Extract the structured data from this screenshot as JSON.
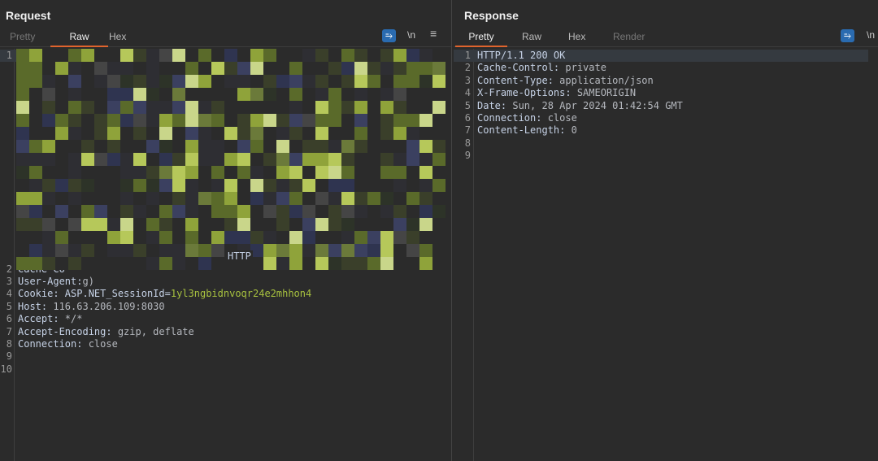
{
  "request": {
    "title": "Request",
    "tabs": [
      {
        "label": "Pretty"
      },
      {
        "label": "Raw",
        "active": true
      },
      {
        "label": "Hex"
      }
    ],
    "tools": {
      "wrap_icon": "wrap-lines-icon",
      "newline_label": "\\n",
      "menu_icon": "hamburger-menu-icon"
    },
    "redacted_line_1_tail": "HTTP",
    "lines": [
      {
        "n": "2",
        "key": "Cache-Co",
        "val": ""
      },
      {
        "n": "3",
        "key": "User-Agent:",
        "val": "g)"
      },
      {
        "n": "4",
        "key": "Cookie: ASP.NET_SessionId=",
        "val": "1yl3ngbidnvoqr24e2mhhon4"
      },
      {
        "n": "5",
        "key": "Host:",
        "val": " 116.63.206.109:8030"
      },
      {
        "n": "6",
        "key": "Accept:",
        "val": " */*"
      },
      {
        "n": "7",
        "key": "Accept-Encoding:",
        "val": " gzip, deflate"
      },
      {
        "n": "8",
        "key": "Connection:",
        "val": " close"
      },
      {
        "n": "9",
        "key": "",
        "val": ""
      },
      {
        "n": "10",
        "key": "",
        "val": ""
      }
    ]
  },
  "response": {
    "title": "Response",
    "tabs": [
      {
        "label": "Pretty",
        "active": true
      },
      {
        "label": "Raw"
      },
      {
        "label": "Hex"
      },
      {
        "label": "Render"
      }
    ],
    "tools": {
      "wrap_icon": "wrap-lines-icon",
      "newline_label": "\\n"
    },
    "lines": [
      {
        "n": "1",
        "key": "HTTP/1.1 200 OK",
        "val": ""
      },
      {
        "n": "2",
        "key": "Cache-Control:",
        "val": " private"
      },
      {
        "n": "3",
        "key": "Content-Type:",
        "val": " application/json"
      },
      {
        "n": "4",
        "key": "X-Frame-Options:",
        "val": " SAMEORIGIN"
      },
      {
        "n": "5",
        "key": "Date:",
        "val": " Sun, 28 Apr 2024 01:42:54 GMT"
      },
      {
        "n": "6",
        "key": "Connection:",
        "val": " close"
      },
      {
        "n": "7",
        "key": "Content-Length:",
        "val": " 0"
      },
      {
        "n": "8",
        "key": "",
        "val": ""
      },
      {
        "n": "9",
        "key": "",
        "val": ""
      }
    ]
  },
  "layout_toggle": {
    "side_by_side_icon": "columns-icon",
    "stacked_icon": "rows-icon",
    "active": "side_by_side"
  },
  "colors": {
    "accent": "#e0642d",
    "button": "#2a6bb0",
    "header_key": "#c6d2e6",
    "value": "#b5b8be",
    "cookie": "#a7c13f"
  }
}
